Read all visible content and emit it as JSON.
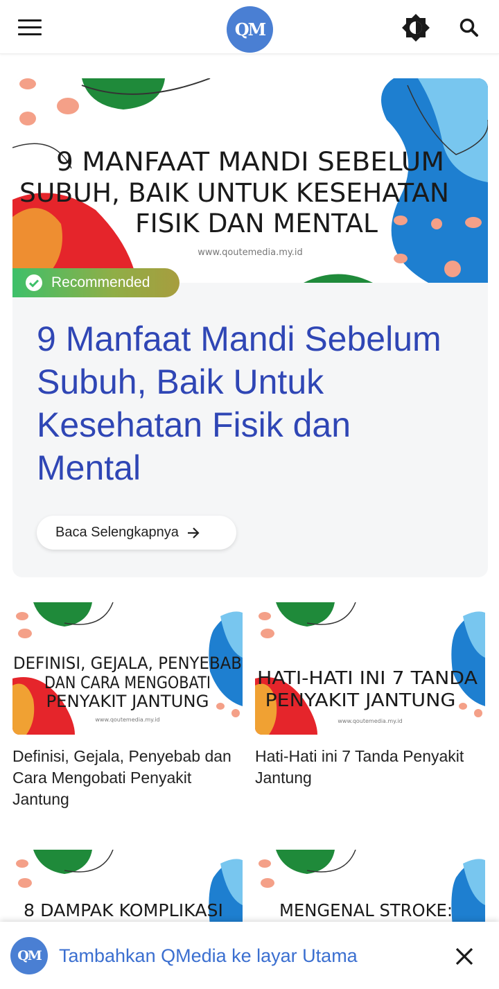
{
  "header": {
    "logo_text": "QM",
    "menu_icon": "hamburger-menu-icon",
    "theme_icon": "brightness-icon",
    "search_icon": "search-icon"
  },
  "featured": {
    "image_headline_1": "9 MANFAAT MANDI SEBELUM",
    "image_headline_2": "SUBUH, BAIK UNTUK KESEHATAN",
    "image_headline_3": "FISIK DAN MENTAL",
    "image_url_text": "www.qoutemedia.my.id",
    "badge_label": "Recommended",
    "title": "9 Manfaat Mandi Sebelum Subuh, Baik Untuk Kesehatan Fisik dan Mental",
    "read_more_label": "Baca Selengkapnya"
  },
  "articles": [
    {
      "image_lines": [
        "DEFINISI, GEJALA, PENYEBAB",
        "DAN CARA MENGOBATI",
        "PENYAKIT JANTUNG"
      ],
      "image_url_text": "www.qoutemedia.my.id",
      "title": "Definisi, Gejala, Penyebab dan Cara Mengobati Penyakit Jantung"
    },
    {
      "image_lines": [
        "HATI-HATI INI 7 TANDA",
        "PENYAKIT JANTUNG"
      ],
      "image_url_text": "www.qoutemedia.my.id",
      "title": "Hati-Hati ini 7 Tanda Penyakit Jantung"
    },
    {
      "image_lines": [
        "8 DAMPAK KOMPLIKASI"
      ],
      "title": ""
    },
    {
      "image_lines": [
        "MENGENAL STROKE:"
      ],
      "title": ""
    }
  ],
  "install_bar": {
    "icon_text": "QM",
    "label": "Tambahkan QMedia ke layar Utama",
    "close_icon": "close-icon"
  },
  "colors": {
    "brand_blue": "#4a7fd3",
    "title_blue": "#2f46b5",
    "badge_green": "#3ec06a",
    "art_red": "#e5252b",
    "art_blue": "#1e7fd0",
    "art_green": "#1f8a3a",
    "art_salmon": "#f4a088"
  }
}
